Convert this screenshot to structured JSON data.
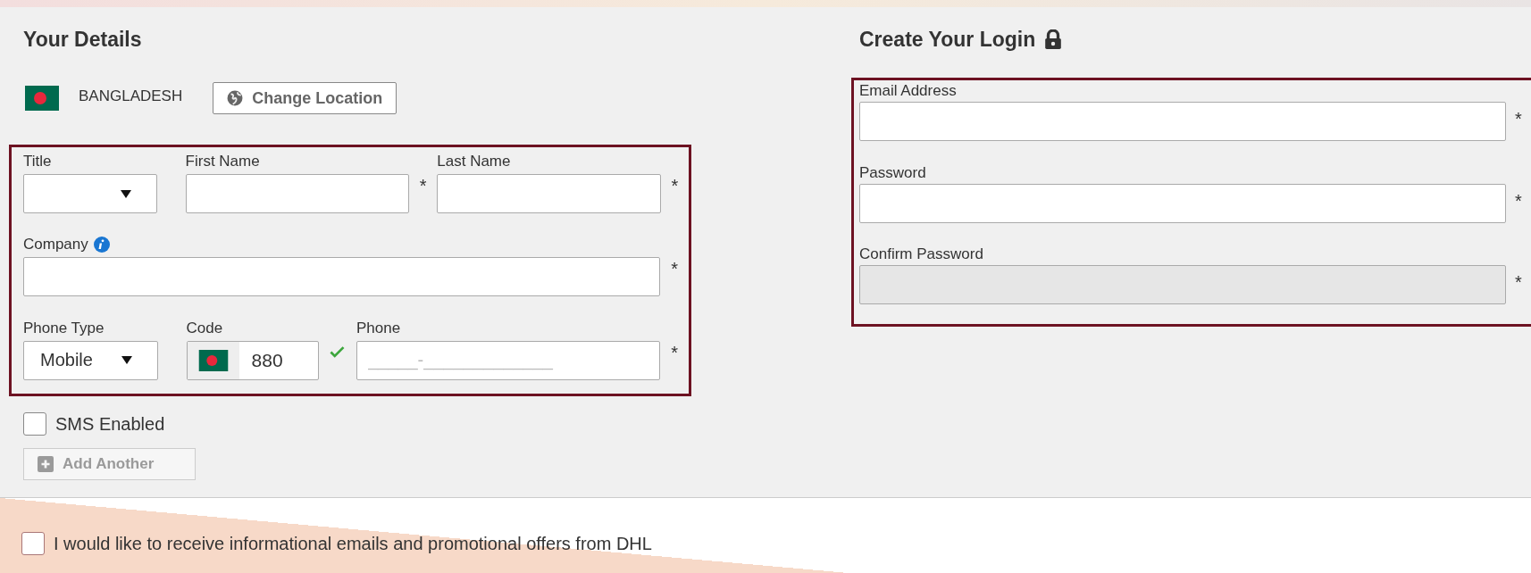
{
  "details": {
    "title": "Your Details",
    "country": "BANGLADESH",
    "change_location": "Change Location",
    "fields": [
      {
        "label": "Title",
        "kind": "select"
      },
      {
        "label": "First Name",
        "kind": "text",
        "required_mark": "*"
      },
      {
        "label": "Last Name",
        "kind": "text",
        "required_mark": "*"
      },
      {
        "label": "Company",
        "kind": "text",
        "info": true,
        "required_mark": "*"
      },
      {
        "label": "Phone Type",
        "kind": "select",
        "value": "Mobile"
      },
      {
        "label": "Code",
        "kind": "code",
        "value": "880",
        "valid": true
      },
      {
        "label": "Phone",
        "kind": "text",
        "placeholder": "_____-_____________",
        "required_mark": "*"
      }
    ],
    "sms": {
      "label": "SMS Enabled",
      "checked": false
    },
    "add_another": {
      "label": "Add Another",
      "disabled": true
    }
  },
  "login": {
    "title": "Create Your Login",
    "fields": [
      {
        "label": "Email Address",
        "disabled": false,
        "required_mark": "*"
      },
      {
        "label": "Password",
        "disabled": false,
        "required_mark": "*"
      },
      {
        "label": "Confirm Password",
        "disabled": true,
        "required_mark": "*"
      }
    ]
  },
  "promo": {
    "label": "I would like to receive informational emails and promotional offers from DHL",
    "checked": false
  }
}
